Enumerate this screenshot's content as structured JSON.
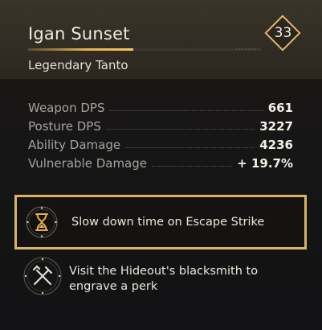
{
  "item": {
    "name": "Igan Sunset",
    "type": "Legendary Tanto",
    "level": "33",
    "progress": 0.45
  },
  "stats": [
    {
      "label": "Weapon DPS",
      "value": "661"
    },
    {
      "label": "Posture DPS",
      "value": "3227"
    },
    {
      "label": "Ability Damage",
      "value": "4236"
    },
    {
      "label": "Vulnerable Damage",
      "value": "+ 19.7%"
    }
  ],
  "perks": {
    "active": {
      "icon": "hourglass-icon",
      "text": "Slow down time on Escape Strike"
    },
    "empty": {
      "icon": "blacksmith-tools-icon",
      "text": "Visit the Hideout's blacksmith to engrave a perk"
    }
  },
  "colors": {
    "accent_gold": "#d7b465",
    "progress_gold": "#e6b24d",
    "text_primary": "#f4efe6",
    "text_secondary": "#a8a39b"
  }
}
